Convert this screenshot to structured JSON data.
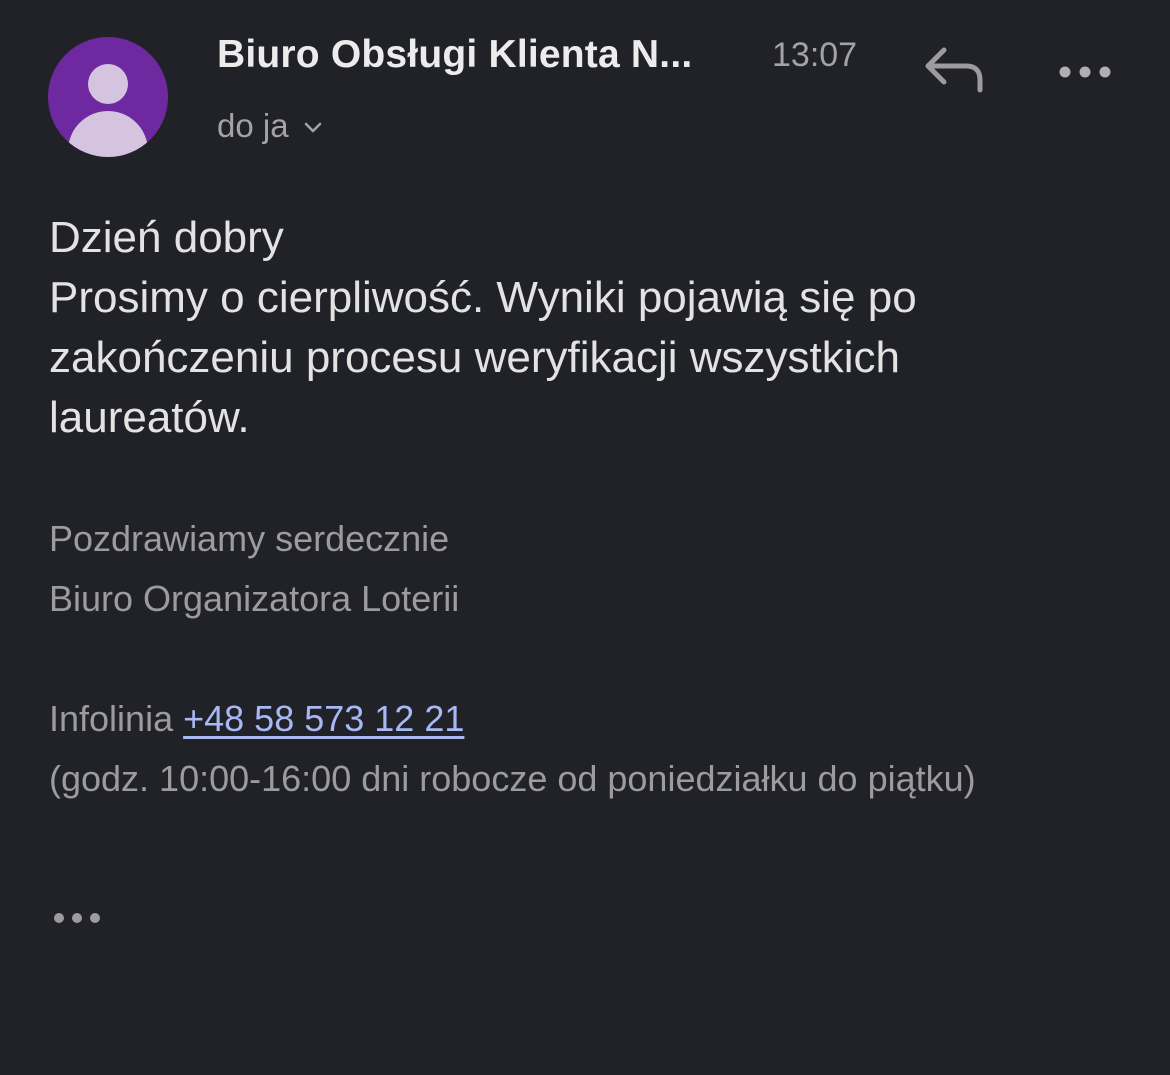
{
  "header": {
    "sender_name": "Biuro Obsługi Klienta N...",
    "time": "13:07",
    "recipient_label": "do ja"
  },
  "icons": {
    "avatar": "person-icon",
    "reply": "reply-icon",
    "more": "more-options-icon",
    "expand": "chevron-down-icon",
    "trimmed": "show-trimmed-content-icon"
  },
  "message": {
    "greeting": "Dzień dobry",
    "body_lines": [
      "Prosimy o cierpliwość. Wyniki pojawią się po",
      "zakończeniu procesu weryfikacji wszystkich",
      "laureatów."
    ],
    "signature": {
      "closing": "Pozdrawiamy serdecznie",
      "organization": "Biuro Organizatora Loterii",
      "infoline_label": "Infolinia",
      "phone": "+48 58 573 12 21",
      "hours": "(godz. 10:00-16:00 dni robocze od poniedziałku do piątku)"
    }
  },
  "colors": {
    "background": "#212227",
    "avatar": "#6f29a0",
    "link": "#a7b8f4"
  }
}
